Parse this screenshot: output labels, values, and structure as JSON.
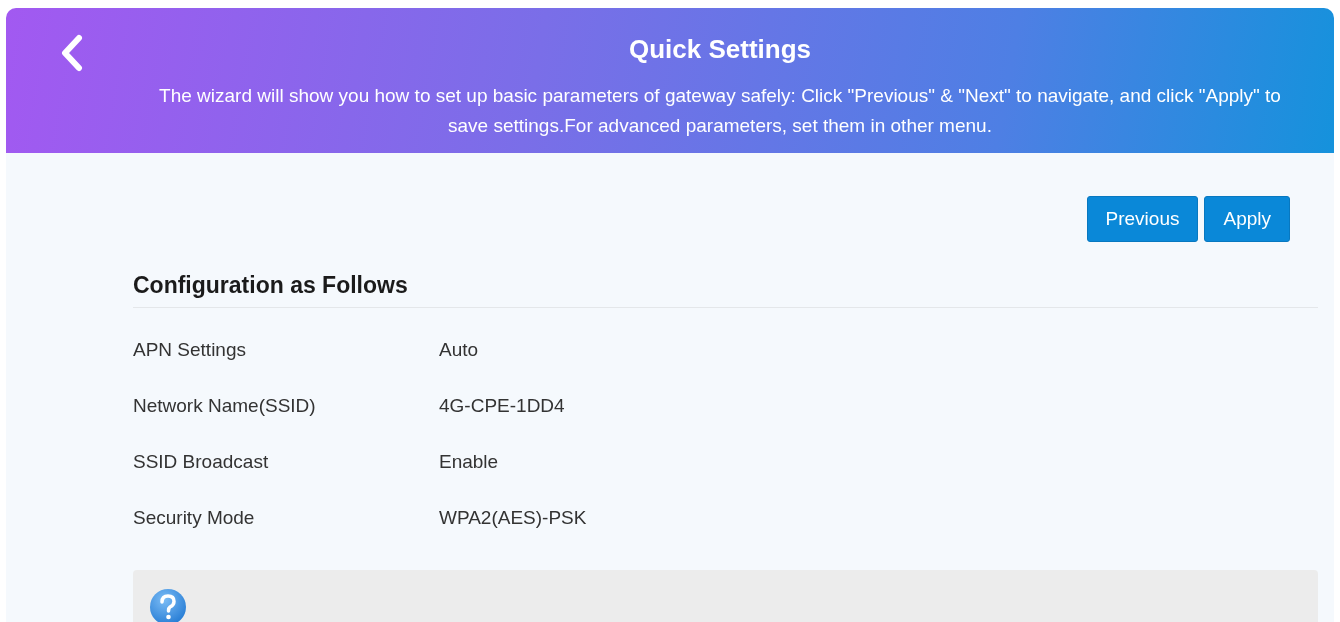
{
  "header": {
    "title": "Quick Settings",
    "description": "The wizard will show you how to set up basic parameters of gateway safely: Click \"Previous\" & \"Next\" to navigate, and click \"Apply\" to save settings.For advanced parameters, set them in other menu."
  },
  "buttons": [
    "Previous",
    "Apply"
  ],
  "section": {
    "title": "Configuration as Follows",
    "rows": [
      {
        "label": "APN Settings",
        "value": "Auto"
      },
      {
        "label": "Network Name(SSID)",
        "value": "4G-CPE-1DD4"
      },
      {
        "label": "SSID Broadcast",
        "value": "Enable"
      },
      {
        "label": "Security Mode",
        "value": "WPA2(AES)-PSK"
      }
    ]
  }
}
